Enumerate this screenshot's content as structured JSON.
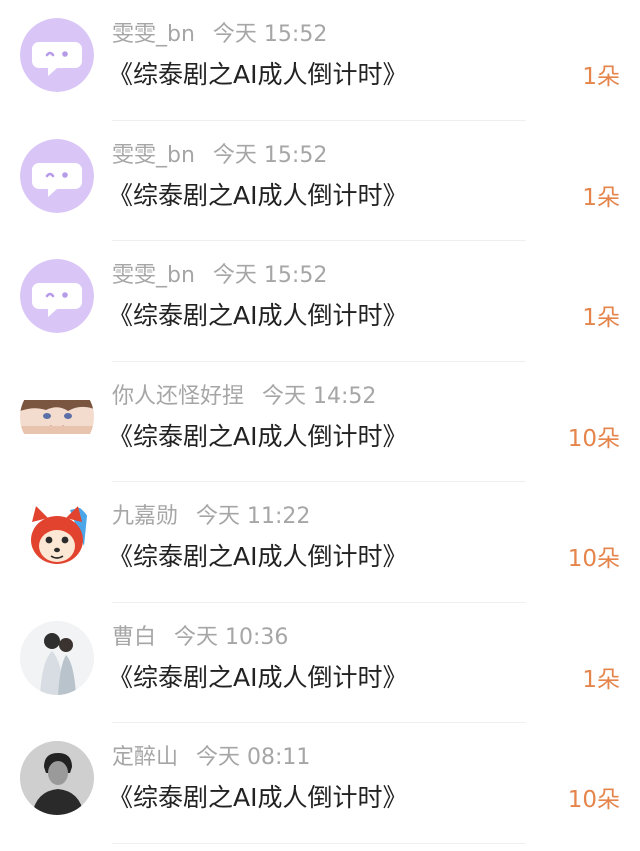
{
  "colors": {
    "accent": "#e5854b",
    "name_text": "#a6a6a6",
    "title_text": "#222222",
    "purple_avatar": "#d9c6f6"
  },
  "items": [
    {
      "name": "雯雯_bn",
      "time": "今天 15:52",
      "title": "《综泰剧之AI成人倒计时》",
      "count": "1朵",
      "avatar": "purple-chat-icon"
    },
    {
      "name": "雯雯_bn",
      "time": "今天 15:52",
      "title": "《综泰剧之AI成人倒计时》",
      "count": "1朵",
      "avatar": "purple-chat-icon"
    },
    {
      "name": "雯雯_bn",
      "time": "今天 15:52",
      "title": "《综泰剧之AI成人倒计时》",
      "count": "1朵",
      "avatar": "purple-chat-icon"
    },
    {
      "name": "你人还怪好捏",
      "time": "今天 14:52",
      "title": "《综泰剧之AI成人倒计时》",
      "count": "10朵",
      "avatar": "anime-boy-avatar"
    },
    {
      "name": "九嘉勋",
      "time": "今天 11:22",
      "title": "《综泰剧之AI成人倒计时》",
      "count": "10朵",
      "avatar": "red-fox-avatar"
    },
    {
      "name": "曹白",
      "time": "今天 10:36",
      "title": "《综泰剧之AI成人倒计时》",
      "count": "1朵",
      "avatar": "couple-photo-avatar"
    },
    {
      "name": "定醉山",
      "time": "今天 08:11",
      "title": "《综泰剧之AI成人倒计时》",
      "count": "10朵",
      "avatar": "portrait-photo-avatar"
    }
  ]
}
